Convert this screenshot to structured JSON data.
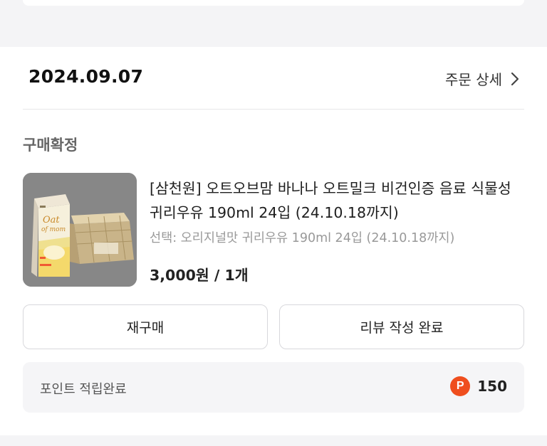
{
  "order": {
    "date": "2024.09.07",
    "detail_label": "주문 상세",
    "status": "구매확정"
  },
  "product": {
    "image_icon": "oat-milk-carton-box-image",
    "title": "[삼천원] 오트오브맘 바나나 오트밀크 비건인증 음료 식물성 귀리우유 190ml 24입 (24.10.18까지)",
    "option": "선택: 오리지널맛 귀리우유 190ml 24입 (24.10.18까지)",
    "price": "3,000원 / 1개"
  },
  "actions": {
    "rebuy_label": "재구매",
    "review_label": "리뷰 작성 완료"
  },
  "points": {
    "label": "포인트 적립완료",
    "badge": "P",
    "value": "150",
    "badge_color": "#ef4e1e"
  }
}
